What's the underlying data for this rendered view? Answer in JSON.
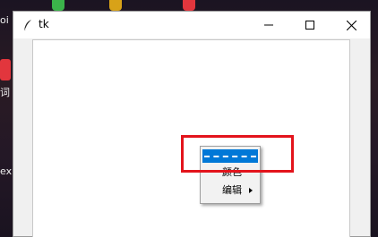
{
  "desktop": {
    "label_1": "oi",
    "label_2": "词",
    "label_3": "ex"
  },
  "window": {
    "title": "tk",
    "icon": "feather-icon",
    "controls": [
      "minimize-icon",
      "maximize-icon",
      "close-icon"
    ]
  },
  "context_menu": {
    "tearoff": "tearoff-dashed-line",
    "items": [
      {
        "label": "颜色"
      },
      {
        "label": "编辑",
        "submenu": true
      }
    ],
    "highlight_color": "#0078d7"
  },
  "annotation": {
    "box_color": "#e3141c"
  }
}
